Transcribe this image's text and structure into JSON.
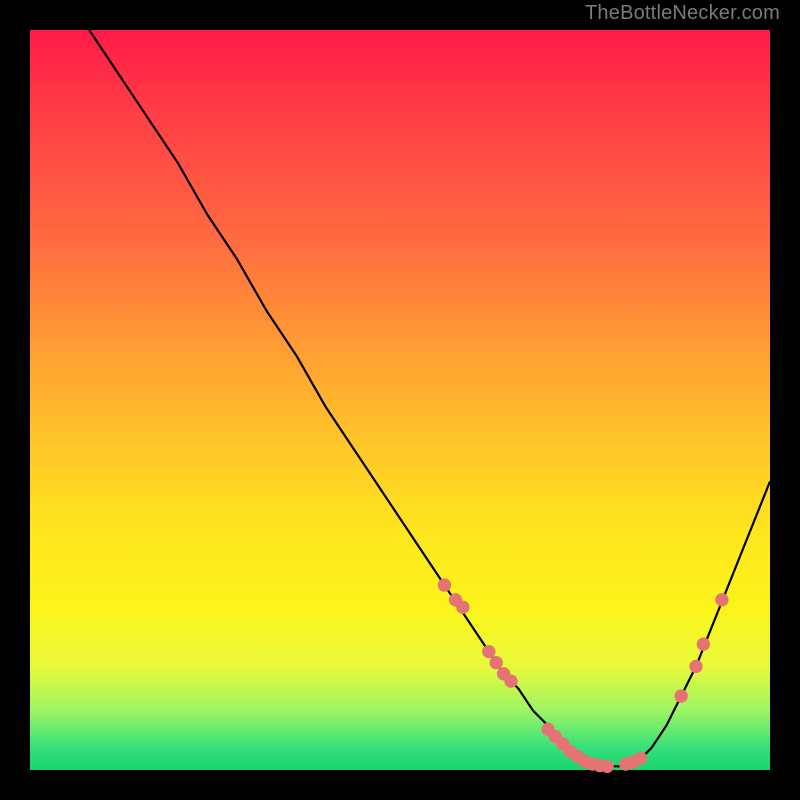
{
  "attribution": "TheBottleNecker.com",
  "colors": {
    "page_bg": "#000000",
    "curve_stroke": "#000000",
    "marker_fill": "#e57373",
    "gradient_top": "#ff1a47",
    "gradient_bottom": "#17d56e"
  },
  "chart_data": {
    "type": "line",
    "title": "",
    "xlabel": "",
    "ylabel": "",
    "xlim": [
      0,
      100
    ],
    "ylim": [
      0,
      100
    ],
    "grid": false,
    "x": [
      8,
      12,
      16,
      20,
      24,
      28,
      32,
      36,
      40,
      44,
      48,
      52,
      56,
      58,
      60,
      62,
      64,
      66,
      68,
      70,
      72,
      74,
      76,
      78,
      80,
      82,
      84,
      86,
      88,
      90,
      92,
      94,
      96,
      98,
      100
    ],
    "y": [
      100,
      94,
      88,
      82,
      75,
      69,
      62,
      56,
      49,
      43,
      37,
      31,
      25,
      22,
      19,
      16,
      13,
      11,
      8,
      6,
      4,
      2,
      1,
      0.5,
      0.5,
      1,
      3,
      6,
      10,
      14,
      19,
      24,
      29,
      34,
      39
    ],
    "markers": {
      "shape": "circle",
      "radius_pct": 0.9,
      "points": [
        {
          "x": 56,
          "y": 25
        },
        {
          "x": 57.5,
          "y": 23
        },
        {
          "x": 58.5,
          "y": 22
        },
        {
          "x": 62,
          "y": 16
        },
        {
          "x": 63,
          "y": 14.5
        },
        {
          "x": 64,
          "y": 13
        },
        {
          "x": 65,
          "y": 12
        },
        {
          "x": 70,
          "y": 5.5
        },
        {
          "x": 71,
          "y": 4.5
        },
        {
          "x": 72,
          "y": 3.5
        },
        {
          "x": 73,
          "y": 2.5
        },
        {
          "x": 74,
          "y": 1.8
        },
        {
          "x": 75,
          "y": 1.2
        },
        {
          "x": 76,
          "y": 0.8
        },
        {
          "x": 77,
          "y": 0.6
        },
        {
          "x": 78,
          "y": 0.5
        },
        {
          "x": 80.5,
          "y": 0.8
        },
        {
          "x": 81.5,
          "y": 1.1
        },
        {
          "x": 82.5,
          "y": 1.6
        },
        {
          "x": 88,
          "y": 10
        },
        {
          "x": 90,
          "y": 14
        },
        {
          "x": 91,
          "y": 17
        },
        {
          "x": 93.5,
          "y": 23
        }
      ]
    }
  }
}
